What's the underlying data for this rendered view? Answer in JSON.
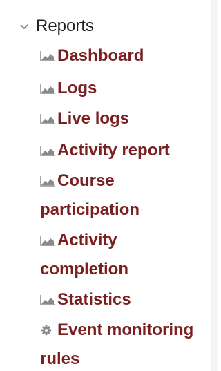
{
  "section": {
    "title": "Reports",
    "expanded": true
  },
  "items": [
    {
      "label": "Dashboard",
      "icon": "report-chart-icon"
    },
    {
      "label": "Logs",
      "icon": "report-chart-icon"
    },
    {
      "label": "Live logs",
      "icon": "report-chart-icon"
    },
    {
      "label": "Activity report",
      "icon": "report-chart-icon"
    },
    {
      "label_line1": "Course",
      "label_line2": "participation",
      "icon": "report-chart-icon"
    },
    {
      "label_line1": "Activity",
      "label_line2": "completion",
      "icon": "report-chart-icon"
    },
    {
      "label": "Statistics",
      "icon": "report-chart-icon"
    },
    {
      "label_line1": "Event monitoring",
      "label_line2": "rules",
      "icon": "gear-icon"
    }
  ],
  "colors": {
    "link": "#7a1f1f",
    "text": "#1d2125",
    "icon": "#8a8a8a"
  }
}
